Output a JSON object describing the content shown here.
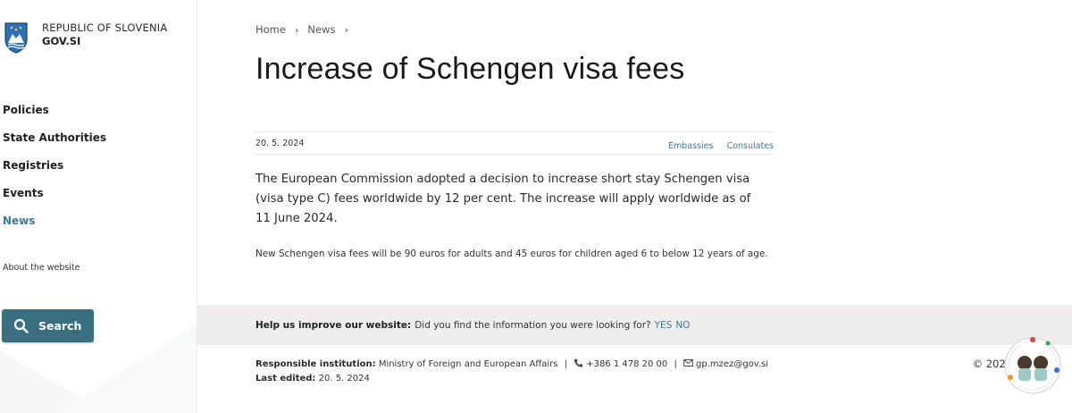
{
  "brand": {
    "line1": "REPUBLIC OF SLOVENIA",
    "line2": "GOV.SI",
    "logo_icon": "slovenia-coat-of-arms-icon"
  },
  "sidebar": {
    "nav": [
      {
        "label": "Policies",
        "active": false
      },
      {
        "label": "State Authorities",
        "active": false
      },
      {
        "label": "Registries",
        "active": false
      },
      {
        "label": "Events",
        "active": false
      },
      {
        "label": "News",
        "active": true
      }
    ],
    "about_label": "About the website",
    "search_label": "Search",
    "search_icon": "search-icon"
  },
  "breadcrumb": {
    "items": [
      "Home",
      "News"
    ],
    "separator": "›"
  },
  "article": {
    "title": "Increase of Schengen visa fees",
    "date": "20. 5. 2024",
    "tags": [
      "Embassies",
      "Consulates"
    ],
    "lead": "The European Commission adopted a decision to increase short stay Schengen visa (visa type C) fees worldwide by 12 per cent. The increase will apply worldwide as of 11 June 2024.",
    "body": "New Schengen visa fees will be 90 euros for adults and 45 euros for children aged 6 to below 12 years of age."
  },
  "feedback": {
    "title": "Help us improve our website:",
    "question": "Did you find the information you were looking for?",
    "yes": "YES",
    "no": "NO"
  },
  "footer": {
    "responsible_label": "Responsible institution:",
    "institution": "Ministry of Foreign and European Affairs",
    "divider": "|",
    "phone": "+386 1 478 20 00",
    "email": "gp.mzez@gov.si",
    "last_edited_label": "Last edited:",
    "last_edited": "20. 5. 2024",
    "copyright": "© 2024"
  },
  "colors": {
    "accent": "#3d7a8f",
    "search_button": "#3a6f80",
    "feedback_bg": "#efeeec"
  }
}
